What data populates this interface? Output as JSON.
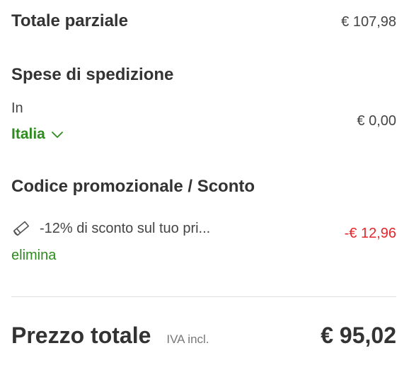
{
  "subtotal": {
    "label": "Totale parziale",
    "amount": "€ 107,98"
  },
  "shipping": {
    "title": "Spese di spedizione",
    "prefix": "In",
    "country": "Italia",
    "amount": "€ 0,00",
    "country_icon": "chevron-down-icon"
  },
  "promo": {
    "title": "Codice promozionale / Sconto",
    "description": "-12% di sconto sul tuo pri...",
    "amount": "-€ 12,96",
    "remove_label": "elimina",
    "icon": "tag-icon"
  },
  "total": {
    "label": "Prezzo totale",
    "vat_note": "IVA incl.",
    "amount": "€ 95,02"
  },
  "colors": {
    "text": "#333333",
    "accent_green": "#2e8b1f",
    "discount_red": "#e4262c",
    "divider": "#e2e2e2"
  }
}
